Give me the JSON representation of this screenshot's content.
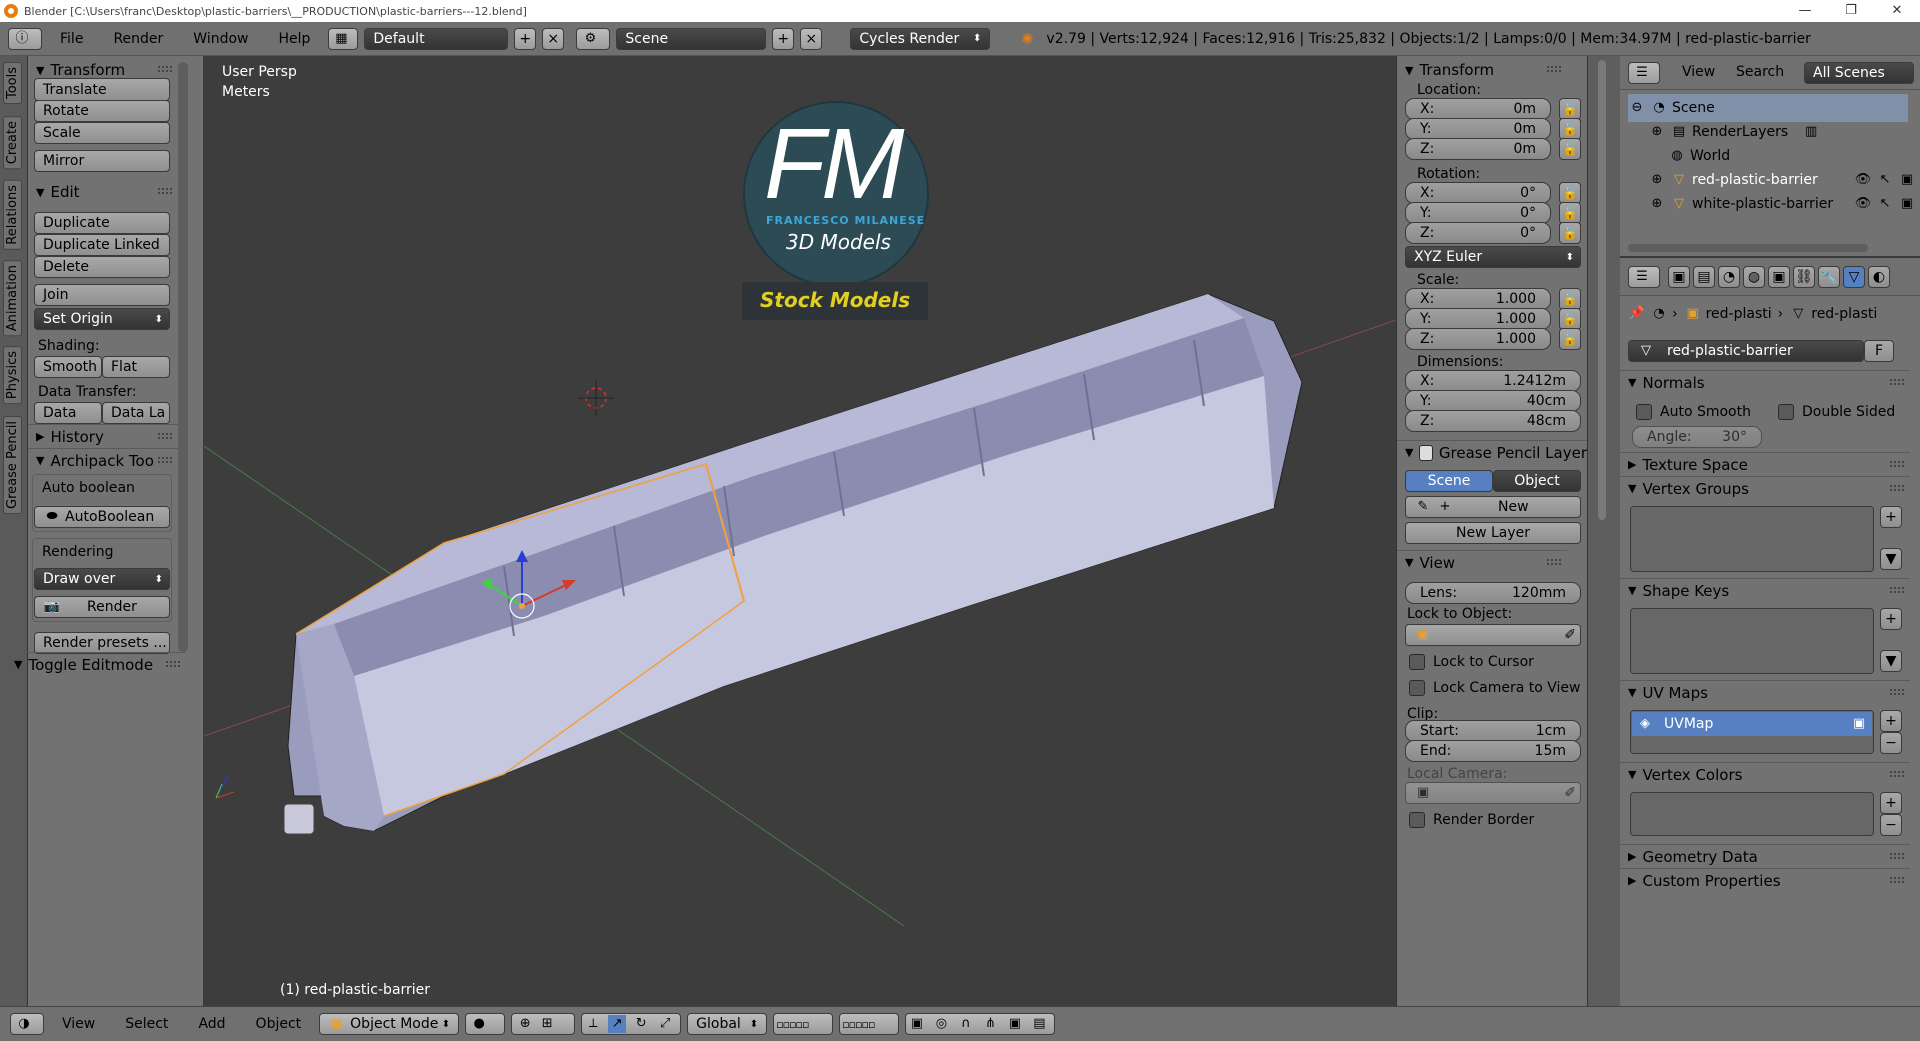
{
  "window": {
    "title": "Blender [C:\\Users\\franc\\Desktop\\plastic-barriers\\__PRODUCTION\\plastic-barriers---12.blend]",
    "minimize": "—",
    "restore": "❐",
    "close": "✕"
  },
  "infobar": {
    "menus": [
      "File",
      "Render",
      "Window",
      "Help"
    ],
    "layout": "Default",
    "scene": "Scene",
    "engine": "Cycles Render",
    "stats": "v2.79 | Verts:12,924 | Faces:12,916 | Tris:25,832 | Objects:1/2 | Lamps:0/0 | Mem:34.97M | red-plastic-barrier"
  },
  "tool_tabs": [
    "Tools",
    "Create",
    "Relations",
    "Animation",
    "Physics",
    "Grease Pencil"
  ],
  "toolshelf": {
    "transform_title": "Transform",
    "translate": "Translate",
    "rotate": "Rotate",
    "scale": "Scale",
    "mirror": "Mirror",
    "edit_title": "Edit",
    "duplicate": "Duplicate",
    "duplicate_linked": "Duplicate Linked",
    "delete": "Delete",
    "join": "Join",
    "set_origin": "Set Origin",
    "shading_label": "Shading:",
    "smooth": "Smooth",
    "flat": "Flat",
    "data_transfer_label": "Data Transfer:",
    "data": "Data",
    "data_la": "Data La",
    "history_title": "History",
    "archipack_title": "Archipack Too",
    "auto_boolean_label": "Auto boolean",
    "auto_boolean_btn": "AutoBoolean",
    "rendering_label": "Rendering",
    "draw_over": "Draw over",
    "render_btn": "Render",
    "render_presets": "Render presets ...",
    "toggle_editmode": "Toggle Editmode"
  },
  "viewport": {
    "view_name": "User Persp",
    "units": "Meters",
    "object_label": "(1) red-plastic-barrier",
    "watermark_big": "FM",
    "watermark_name": "FRANCESCO MILANESE",
    "watermark_sub": "3D Models",
    "watermark_stock": "Stock Models"
  },
  "nprops": {
    "transform_title": "Transform",
    "location_label": "Location:",
    "location": [
      {
        "k": "X:",
        "v": "0m"
      },
      {
        "k": "Y:",
        "v": "0m"
      },
      {
        "k": "Z:",
        "v": "0m"
      }
    ],
    "rotation_label": "Rotation:",
    "rotation": [
      {
        "k": "X:",
        "v": "0°"
      },
      {
        "k": "Y:",
        "v": "0°"
      },
      {
        "k": "Z:",
        "v": "0°"
      }
    ],
    "rotation_mode": "XYZ Euler",
    "scale_label": "Scale:",
    "scale": [
      {
        "k": "X:",
        "v": "1.000"
      },
      {
        "k": "Y:",
        "v": "1.000"
      },
      {
        "k": "Z:",
        "v": "1.000"
      }
    ],
    "dimensions_label": "Dimensions:",
    "dimensions": [
      {
        "k": "X:",
        "v": "1.2412m"
      },
      {
        "k": "Y:",
        "v": "40cm"
      },
      {
        "k": "Z:",
        "v": "48cm"
      }
    ],
    "grease_title": "Grease Pencil Layer",
    "scene_tab": "Scene",
    "object_tab": "Object",
    "new_btn": "New",
    "new_layer_btn": "New Layer",
    "view_title": "View",
    "lens_label": "Lens:",
    "lens_value": "120mm",
    "lock_object_label": "Lock to Object:",
    "lock_cursor": "Lock to Cursor",
    "lock_camera": "Lock Camera to View",
    "clip_label": "Clip:",
    "clip_start_label": "Start:",
    "clip_start": "1cm",
    "clip_end_label": "End:",
    "clip_end": "15m",
    "local_camera_label": "Local Camera:",
    "render_border": "Render Border"
  },
  "outliner": {
    "view": "View",
    "search": "Search",
    "all_scenes": "All Scenes",
    "items": [
      "Scene",
      "RenderLayers",
      "World",
      "red-plastic-barrier",
      "white-plastic-barrier"
    ]
  },
  "properties": {
    "breadcrumb_obj": "red-plasti",
    "breadcrumb_mesh": "red-plasti",
    "mesh_name": "red-plastic-barrier",
    "fake_user": "F",
    "normals_title": "Normals",
    "auto_smooth": "Auto Smooth",
    "double_sided": "Double Sided",
    "angle_label": "Angle:",
    "angle_value": "30°",
    "texture_space": "Texture Space",
    "vertex_groups": "Vertex Groups",
    "shape_keys": "Shape Keys",
    "uv_maps": "UV Maps",
    "uvmap_item": "UVMap",
    "vertex_colors": "Vertex Colors",
    "geometry_data": "Geometry Data",
    "custom_properties": "Custom Properties"
  },
  "bottombar": {
    "menus": [
      "View",
      "Select",
      "Add",
      "Object"
    ],
    "mode": "Object Mode",
    "orientation": "Global"
  },
  "colors": {
    "panel": "#727272",
    "viewport_bg": "#3d3d3d",
    "selection_blue": "#5680c2",
    "barrier": "#aeb0cc",
    "outline_orange": "#f0a040",
    "watermark_yellow": "#e0d020"
  }
}
